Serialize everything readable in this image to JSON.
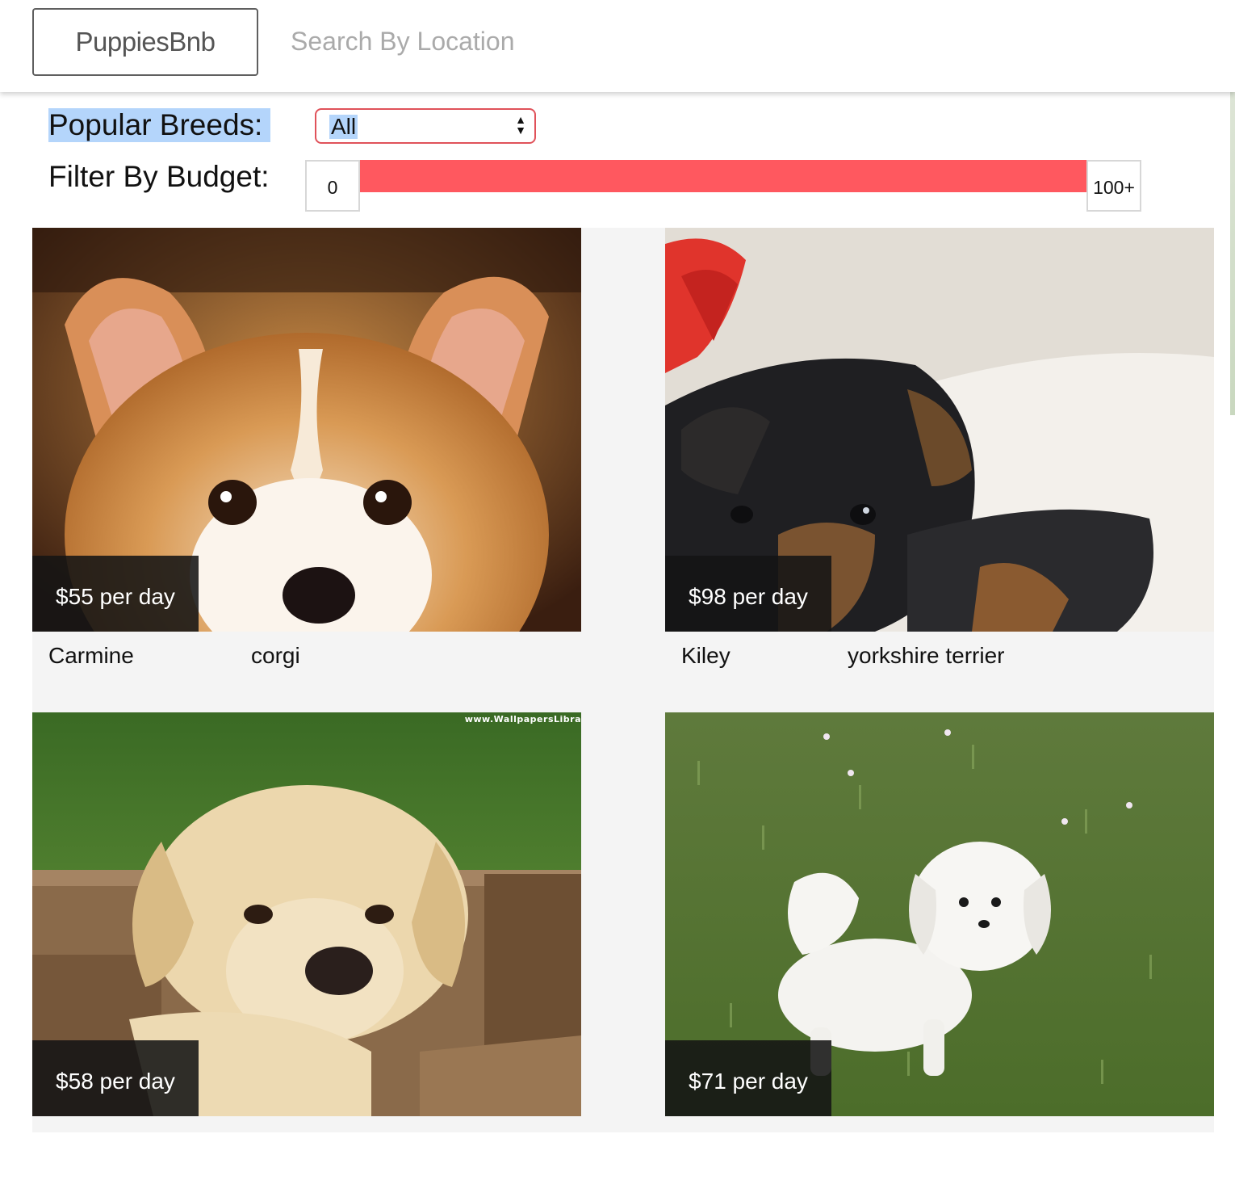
{
  "header": {
    "brand": "PuppiesBnb",
    "search_placeholder": "Search By Location"
  },
  "filters": {
    "breeds_label": "Popular Breeds:",
    "breed_selected": "All",
    "budget_label": "Filter By Budget:",
    "budget_min": "0",
    "budget_max": "100+",
    "budget_range_fraction": [
      0,
      1
    ]
  },
  "listings": [
    {
      "price": "$55 per day",
      "name": "Carmine",
      "breed": "corgi",
      "photo_icon": "corgi-puppy-photo"
    },
    {
      "price": "$98 per day",
      "name": "Kiley",
      "breed": "yorkshire terrier",
      "photo_icon": "yorkie-puppy-photo"
    },
    {
      "price": "$58 per day",
      "name": "",
      "breed": "",
      "photo_icon": "labrador-puppy-photo",
      "watermark": "www.WallpapersLibra"
    },
    {
      "price": "$71 per day",
      "name": "",
      "breed": "",
      "photo_icon": "maltese-puppy-photo"
    }
  ],
  "colors": {
    "accent": "#ff585f",
    "selection": "#b4d5fb",
    "price_badge": "#141414"
  }
}
